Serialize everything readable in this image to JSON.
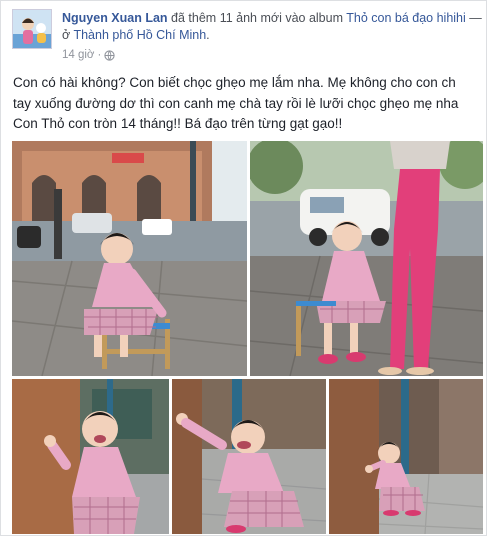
{
  "post": {
    "author": "Nguyen Xuan Lan",
    "action_text": " đã thêm 11 ảnh mới vào album ",
    "album_name": "Thỏ con bá đạo hihihi",
    "location_prefix": " — ở ",
    "location": "Thành phố Hồ Chí Minh",
    "location_suffix": ".",
    "timestamp": "14 giờ",
    "separator": "·",
    "privacy_icon": "globe-icon",
    "caption_lines": [
      "Con có hài không? Con biết chọc ghẹo mẹ lắm nha. Mẹ không cho con ch",
      "tay xuống đường dơ thì con canh mẹ chà tay rồi lè lưỡi chọc ghẹo mẹ nha",
      "Con Thỏ con tròn 14 tháng!! Bá đạo trên từng gạt gạo!!"
    ]
  },
  "colors": {
    "link": "#365899",
    "muted": "#90949c",
    "text": "#1d2129",
    "dress_pink": "#e8a9c6"
  }
}
